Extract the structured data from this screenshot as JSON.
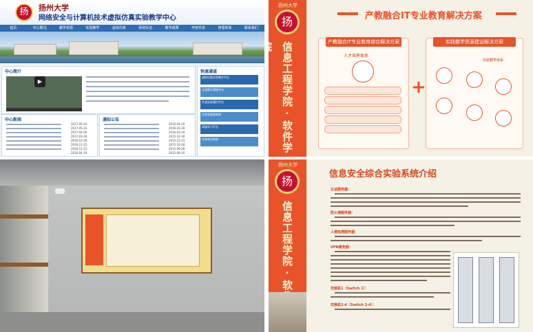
{
  "top_left_site": {
    "university": "扬州大学",
    "center_name": "网络安全与计算机技术虚拟仿真实验教学中心",
    "nav": [
      "首页",
      "中心概况",
      "教学资源",
      "实验教学",
      "虚拟仿真",
      "师资队伍",
      "教学成果",
      "开放共享",
      "管理体系",
      "联系我们"
    ],
    "panel_intro_title": "中心简介",
    "panel_service_title": "快速通道",
    "panel_news_title": "中心新闻",
    "panel_notice_title": "通知公告",
    "service_items": [
      "虚拟仿真实验教学平台",
      "实验教学管理平台",
      "开放实验预约平台",
      "实验室管理系统",
      "网络学习平台",
      "在线考试系统"
    ],
    "news_dates": [
      "2017-05-24",
      "2017-05-23",
      "2017-04-06",
      "2017-03-30",
      "2016-12-28",
      "2016-11-22",
      "2016-11-15",
      "2016-04-19"
    ],
    "notice_dates": [
      "2016-04-20",
      "2016-03-28",
      "2016-03-20",
      "2015-12-30",
      "2015-12-23",
      "2015-10-28",
      "2015-09-28",
      "2015-09-20"
    ]
  },
  "top_right_slide": {
    "university": "扬州大学",
    "side_title": "信息工程学院·软件学院",
    "title": "产教融合IT专业教育解决方案",
    "box_left_title": "产教融合IT专业教育综合解决方案",
    "box_left_label": "人才培养体系",
    "box_right_title": "实践教学资源建设解决方案",
    "box_right_label": "实验教学体系"
  },
  "bottom_right_slide": {
    "university": "扬州大学",
    "side_title": "信息工程学院·软件学院",
    "title": "信息安全综合实验系统介绍",
    "sections": [
      "认证服务器：",
      "防火墙服务器：",
      "入侵检测服务器：",
      "VPN服务器：",
      "交换机1（Switch 1）：",
      "交换机2-4（Switch 2-4）："
    ]
  },
  "colors": {
    "accent": "#e8532a",
    "site_blue": "#2d6db4",
    "seal_red": "#c8102e"
  }
}
